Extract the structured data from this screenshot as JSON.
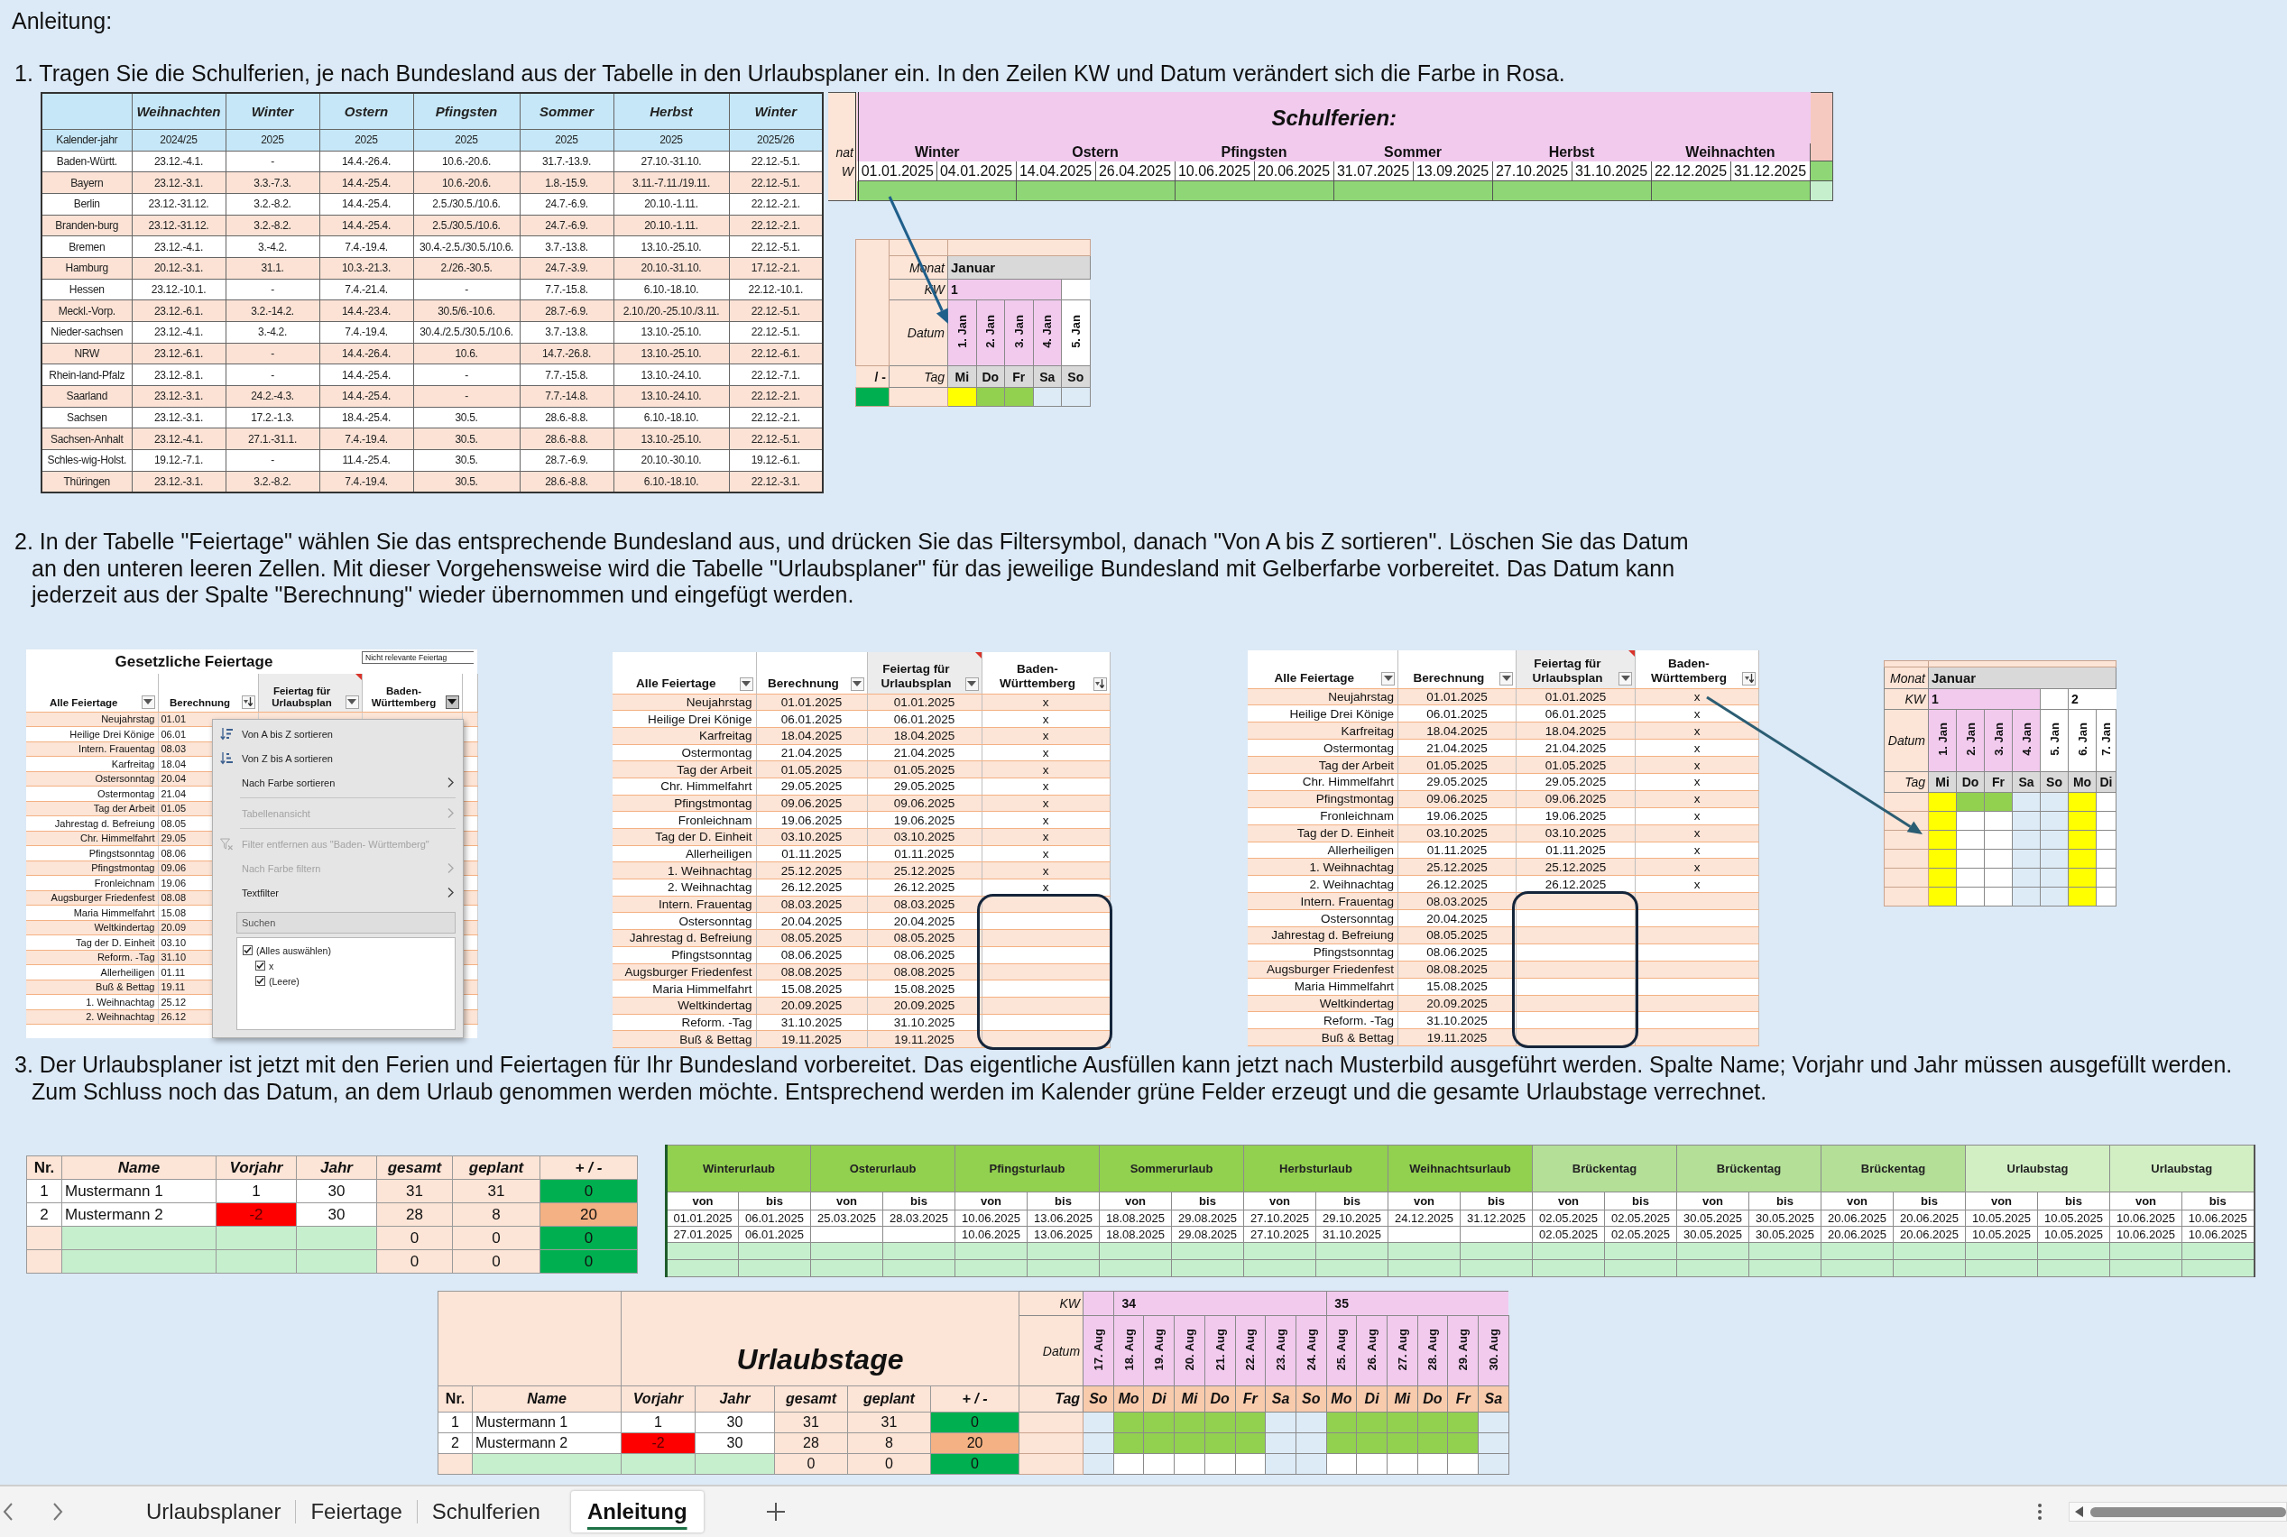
{
  "heading": "Anleitung:",
  "step_1": {
    "lines": [
      "1. Tragen Sie die Schulferien, je nach Bundesland aus der Tabelle in den Urlaubsplaner ein. In den Zeilen KW und Datum verändert sich die Farbe in Rosa."
    ],
    "state_table": {
      "columns": [
        "Weihnachten",
        "Winter",
        "Ostern",
        "Pfingsten",
        "Sommer",
        "Herbst",
        "Winter"
      ],
      "year_label": "Kalender-jahr",
      "years": [
        "2024/25",
        "2025",
        "2025",
        "2025",
        "2025",
        "2025",
        "2025/26"
      ],
      "rows": [
        {
          "state": "Baden-Württ.",
          "periods": [
            "23.12.-4.1.",
            "-",
            "14.4.-26.4.",
            "10.6.-20.6.",
            "31.7.-13.9.",
            "27.10.-31.10.",
            "22.12.-5.1."
          ]
        },
        {
          "state": "Bayern",
          "periods": [
            "23.12.-3.1.",
            "3.3.-7.3.",
            "14.4.-25.4.",
            "10.6.-20.6.",
            "1.8.-15.9.",
            "3.11.-7.11./19.11.",
            "22.12.-5.1."
          ]
        },
        {
          "state": "Berlin",
          "periods": [
            "23.12.-31.12.",
            "3.2.-8.2.",
            "14.4.-25.4.",
            "2.5./30.5./10.6.",
            "24.7.-6.9.",
            "20.10.-1.11.",
            "22.12.-2.1."
          ]
        },
        {
          "state": "Branden-burg",
          "periods": [
            "23.12.-31.12.",
            "3.2.-8.2.",
            "14.4.-25.4.",
            "2.5./30.5./10.6.",
            "24.7.-6.9.",
            "20.10.-1.11.",
            "22.12.-2.1."
          ]
        },
        {
          "state": "Bremen",
          "periods": [
            "23.12.-4.1.",
            "3.-4.2.",
            "7.4.-19.4.",
            "30.4.-2.5./30.5./10.6.",
            "3.7.-13.8.",
            "13.10.-25.10.",
            "22.12.-5.1."
          ]
        },
        {
          "state": "Hamburg",
          "periods": [
            "20.12.-3.1.",
            "31.1.",
            "10.3.-21.3.",
            "2./26.-30.5.",
            "24.7.-3.9.",
            "20.10.-31.10.",
            "17.12.-2.1."
          ]
        },
        {
          "state": "Hessen",
          "periods": [
            "23.12.-10.1.",
            "-",
            "7.4.-21.4.",
            "-",
            "7.7.-15.8.",
            "6.10.-18.10.",
            "22.12.-10.1."
          ]
        },
        {
          "state": "Meckl.-Vorp.",
          "periods": [
            "23.12.-6.1.",
            "3.2.-14.2.",
            "14.4.-23.4.",
            "30.5/6.-10.6.",
            "28.7.-6.9.",
            "2.10./20.-25.10./3.11.",
            "22.12.-5.1."
          ]
        },
        {
          "state": "Nieder-sachsen",
          "periods": [
            "23.12.-4.1.",
            "3.-4.2.",
            "7.4.-19.4.",
            "30.4./2.5./30.5./10.6.",
            "3.7.-13.8.",
            "13.10.-25.10.",
            "22.12.-5.1."
          ]
        },
        {
          "state": "NRW",
          "periods": [
            "23.12.-6.1.",
            "-",
            "14.4.-26.4.",
            "10.6.",
            "14.7.-26.8.",
            "13.10.-25.10.",
            "22.12.-6.1."
          ]
        },
        {
          "state": "Rhein-land-Pfalz",
          "periods": [
            "23.12.-8.1.",
            "-",
            "14.4.-25.4.",
            "-",
            "7.7.-15.8.",
            "13.10.-24.10.",
            "22.12.-7.1."
          ]
        },
        {
          "state": "Saarland",
          "periods": [
            "23.12.-3.1.",
            "24.2.-4.3.",
            "14.4.-25.4.",
            "-",
            "7.7.-14.8.",
            "13.10.-24.10.",
            "22.12.-2.1."
          ]
        },
        {
          "state": "Sachsen",
          "periods": [
            "23.12.-3.1.",
            "17.2.-1.3.",
            "18.4.-25.4.",
            "30.5.",
            "28.6.-8.8.",
            "6.10.-18.10.",
            "22.12.-2.1."
          ]
        },
        {
          "state": "Sachsen-Anhalt",
          "periods": [
            "23.12.-4.1.",
            "27.1.-31.1.",
            "7.4.-19.4.",
            "30.5.",
            "28.6.-8.8.",
            "13.10.-25.10.",
            "22.12.-5.1."
          ]
        },
        {
          "state": "Schles-wig-Holst.",
          "periods": [
            "19.12.-7.1.",
            "-",
            "11.4.-25.4.",
            "30.5.",
            "28.7.-6.9.",
            "20.10.-30.10.",
            "19.12.-6.1."
          ]
        },
        {
          "state": "Thüringen",
          "periods": [
            "23.12.-3.1.",
            "3.2.-8.2.",
            "7.4.-19.4.",
            "30.5.",
            "28.6.-8.8.",
            "6.10.-18.10.",
            "22.12.-3.1."
          ]
        }
      ]
    },
    "school_holidays": {
      "cut_row_labels": [
        "nat",
        "W"
      ],
      "title": "Schulferien:",
      "periods": [
        {
          "name": "Winter",
          "from": "01.01.2025",
          "to": "04.01.2025"
        },
        {
          "name": "Ostern",
          "from": "14.04.2025",
          "to": "26.04.2025"
        },
        {
          "name": "Pfingsten",
          "from": "10.06.2025",
          "to": "20.06.2025"
        },
        {
          "name": "Sommer",
          "from": "31.07.2025",
          "to": "13.09.2025"
        },
        {
          "name": "Herbst",
          "from": "27.10.2025",
          "to": "31.10.2025"
        },
        {
          "name": "Weihnachten",
          "from": "22.12.2025",
          "to": "31.12.2025"
        }
      ]
    },
    "calendar": {
      "cut_column_label": "/ -",
      "cut_balanced": true,
      "month_label": "Monat",
      "month": "Januar",
      "week_label": "KW",
      "date_label": "Datum",
      "day_label": "Tag",
      "days": [
        {
          "date": "1. Jan",
          "weekday": "Mi",
          "week": "1",
          "school_holiday": true
        },
        {
          "date": "2. Jan",
          "weekday": "Do",
          "school_holiday": true
        },
        {
          "date": "3. Jan",
          "weekday": "Fr",
          "school_holiday": true
        },
        {
          "date": "4. Jan",
          "weekday": "Sa",
          "school_holiday": true
        },
        {
          "date": "5. Jan",
          "weekday": "So",
          "school_holiday": false
        }
      ],
      "grid": [
        [
          {
            "kind": "holiday"
          },
          {
            "kind": "vacation"
          },
          {
            "kind": "vacation"
          },
          {
            "kind": "weekend"
          },
          {
            "kind": "weekend"
          }
        ]
      ]
    }
  },
  "step_2": {
    "lines": [
      "2. In der Tabelle \"Feiertage\" wählen Sie das entsprechende Bundesland aus, und drücken Sie das Filtersymbol, danach \"Von A bis Z sortieren\". Löschen Sie das Datum",
      "an den unteren leeren Zellen. Mit dieser Vorgehensweise wird die Tabelle \"Urlaubsplaner\" für das jeweilige Bundesland mit Gelberfarbe vorbereitet. Das Datum kann",
      "jederzeit aus der Spalte \"Berechnung\" wieder übernommen und eingefügt werden."
    ],
    "filter_screenshot": {
      "title": "Gesetzliche Feiertage",
      "note": "Nicht relevante Feiertag",
      "columns": [
        {
          "label": "Alle Feiertage",
          "sorted": false,
          "active": false
        },
        {
          "label": "Berechnung",
          "sorted": true,
          "active": false
        },
        {
          "label": "Feiertag für Urlaubsplan",
          "sorted": false,
          "active": false
        },
        {
          "label": "Baden-Württemberg",
          "sorted": false,
          "active": true
        }
      ],
      "rows": [
        {
          "name": "Neujahrstag",
          "date": "01.01"
        },
        {
          "name": "Heilige Drei Könige",
          "date": "06.01"
        },
        {
          "name": "Intern. Frauentag",
          "date": "08.03"
        },
        {
          "name": "Karfreitag",
          "date": "18.04"
        },
        {
          "name": "Ostersonntag",
          "date": "20.04"
        },
        {
          "name": "Ostermontag",
          "date": "21.04"
        },
        {
          "name": "Tag der Arbeit",
          "date": "01.05"
        },
        {
          "name": "Jahrestag d. Befreiung",
          "date": "08.05"
        },
        {
          "name": "Chr. Himmelfahrt",
          "date": "29.05"
        },
        {
          "name": "Pfingstsonntag",
          "date": "08.06"
        },
        {
          "name": "Pfingstmontag",
          "date": "09.06"
        },
        {
          "name": "Fronleichnam",
          "date": "19.06"
        },
        {
          "name": "Augsburger Friedenfest",
          "date": "08.08"
        },
        {
          "name": "Maria Himmelfahrt",
          "date": "15.08"
        },
        {
          "name": "Weltkindertag",
          "date": "20.09"
        },
        {
          "name": "Tag der D. Einheit",
          "date": "03.10"
        },
        {
          "name": "Reform. -Tag",
          "date": "31.10"
        },
        {
          "name": "Allerheiligen",
          "date": "01.11"
        },
        {
          "name": "Buß & Bettag",
          "date": "19.11"
        },
        {
          "name": "1. Weihnachtag",
          "date": "25.12"
        },
        {
          "name": "2. Weihnachtag",
          "date": "26.12"
        }
      ],
      "menu": {
        "items": [
          {
            "label": "Von A bis Z sortieren",
            "kind": "sort_up",
            "disabled": false,
            "separator_after": false
          },
          {
            "label": "Von Z bis A sortieren",
            "kind": "sort_down",
            "disabled": false,
            "separator_after": false
          },
          {
            "label": "Nach Farbe sortieren",
            "kind": "submenu",
            "disabled": false,
            "separator_after": true
          },
          {
            "label": "Tabellenansicht",
            "kind": "submenu",
            "disabled": true,
            "separator_after": true
          },
          {
            "label": "Filter entfernen aus \"Baden- Württemberg\"",
            "kind": "clear_filter",
            "disabled": true,
            "separator_after": false
          },
          {
            "label": "Nach Farbe filtern",
            "kind": "submenu",
            "disabled": true,
            "separator_after": false
          },
          {
            "label": "Textfilter",
            "kind": "submenu",
            "disabled": false,
            "separator_after": false
          }
        ],
        "search": {
          "placeholder": "Suchen"
        },
        "options": [
          {
            "label": "(Alles auswählen)",
            "checked": true,
            "children": [
              {
                "label": "x",
                "checked": true
              },
              {
                "label": "(Leere)",
                "checked": true
              }
            ]
          }
        ]
      }
    },
    "sorted_table": {
      "columns": [
        {
          "label": "Alle Feiertage",
          "sorted": false,
          "highlighted": false
        },
        {
          "label": "Berechnung",
          "sorted": false,
          "highlighted": false
        },
        {
          "label": "Feiertag für Urlaubsplan",
          "sorted": false,
          "highlighted": false
        },
        {
          "label": "Baden-Württemberg",
          "sorted": true,
          "highlighted": true
        }
      ],
      "rows": [
        {
          "name": "Neujahrstag",
          "date": "01.01.2025",
          "plan_date": "01.01.2025",
          "region_mark": "x"
        },
        {
          "name": "Heilige Drei Könige",
          "date": "06.01.2025",
          "plan_date": "06.01.2025",
          "region_mark": "x"
        },
        {
          "name": "Karfreitag",
          "date": "18.04.2025",
          "plan_date": "18.04.2025",
          "region_mark": "x"
        },
        {
          "name": "Ostermontag",
          "date": "21.04.2025",
          "plan_date": "21.04.2025",
          "region_mark": "x"
        },
        {
          "name": "Tag der Arbeit",
          "date": "01.05.2025",
          "plan_date": "01.05.2025",
          "region_mark": "x"
        },
        {
          "name": "Chr. Himmelfahrt",
          "date": "29.05.2025",
          "plan_date": "29.05.2025",
          "region_mark": "x"
        },
        {
          "name": "Pfingstmontag",
          "date": "09.06.2025",
          "plan_date": "09.06.2025",
          "region_mark": "x"
        },
        {
          "name": "Fronleichnam",
          "date": "19.06.2025",
          "plan_date": "19.06.2025",
          "region_mark": "x"
        },
        {
          "name": "Tag der D. Einheit",
          "date": "03.10.2025",
          "plan_date": "03.10.2025",
          "region_mark": "x"
        },
        {
          "name": "Allerheiligen",
          "date": "01.11.2025",
          "plan_date": "01.11.2025",
          "region_mark": "x"
        },
        {
          "name": "1. Weihnachtag",
          "date": "25.12.2025",
          "plan_date": "25.12.2025",
          "region_mark": "x"
        },
        {
          "name": "2. Weihnachtag",
          "date": "26.12.2025",
          "plan_date": "26.12.2025",
          "region_mark": "x"
        },
        {
          "name": "Intern. Frauentag",
          "date": "08.03.2025",
          "plan_date": "08.03.2025"
        },
        {
          "name": "Ostersonntag",
          "date": "20.04.2025",
          "plan_date": "20.04.2025"
        },
        {
          "name": "Jahrestag d. Befreiung",
          "date": "08.05.2025",
          "plan_date": "08.05.2025"
        },
        {
          "name": "Pfingstsonntag",
          "date": "08.06.2025",
          "plan_date": "08.06.2025"
        },
        {
          "name": "Augsburger Friedenfest",
          "date": "08.08.2025",
          "plan_date": "08.08.2025"
        },
        {
          "name": "Maria Himmelfahrt",
          "date": "15.08.2025",
          "plan_date": "15.08.2025"
        },
        {
          "name": "Weltkindertag",
          "date": "20.09.2025",
          "plan_date": "20.09.2025"
        },
        {
          "name": "Reform. -Tag",
          "date": "31.10.2025",
          "plan_date": "31.10.2025"
        },
        {
          "name": "Buß & Bettag",
          "date": "19.11.2025",
          "plan_date": "19.11.2025"
        }
      ]
    },
    "cleared_table": {
      "columns": [
        {
          "label": "Alle Feiertage",
          "sorted": false,
          "highlighted": false
        },
        {
          "label": "Berechnung",
          "sorted": false,
          "highlighted": false
        },
        {
          "label": "Feiertag für Urlaubsplan",
          "sorted": false,
          "highlighted": true
        },
        {
          "label": "Baden-Württemberg",
          "sorted": true,
          "highlighted": false
        }
      ],
      "rows": [
        {
          "name": "Neujahrstag",
          "date": "01.01.2025",
          "plan_date": "01.01.2025",
          "region_mark": "x"
        },
        {
          "name": "Heilige Drei Könige",
          "date": "06.01.2025",
          "plan_date": "06.01.2025",
          "region_mark": "x"
        },
        {
          "name": "Karfreitag",
          "date": "18.04.2025",
          "plan_date": "18.04.2025",
          "region_mark": "x"
        },
        {
          "name": "Ostermontag",
          "date": "21.04.2025",
          "plan_date": "21.04.2025",
          "region_mark": "x"
        },
        {
          "name": "Tag der Arbeit",
          "date": "01.05.2025",
          "plan_date": "01.05.2025",
          "region_mark": "x"
        },
        {
          "name": "Chr. Himmelfahrt",
          "date": "29.05.2025",
          "plan_date": "29.05.2025",
          "region_mark": "x"
        },
        {
          "name": "Pfingstmontag",
          "date": "09.06.2025",
          "plan_date": "09.06.2025",
          "region_mark": "x"
        },
        {
          "name": "Fronleichnam",
          "date": "19.06.2025",
          "plan_date": "19.06.2025",
          "region_mark": "x"
        },
        {
          "name": "Tag der D. Einheit",
          "date": "03.10.2025",
          "plan_date": "03.10.2025",
          "region_mark": "x"
        },
        {
          "name": "Allerheiligen",
          "date": "01.11.2025",
          "plan_date": "01.11.2025",
          "region_mark": "x"
        },
        {
          "name": "1. Weihnachtag",
          "date": "25.12.2025",
          "plan_date": "25.12.2025",
          "region_mark": "x"
        },
        {
          "name": "2. Weihnachtag",
          "date": "26.12.2025",
          "plan_date": "26.12.2025",
          "region_mark": "x"
        },
        {
          "name": "Intern. Frauentag",
          "date": "08.03.2025"
        },
        {
          "name": "Ostersonntag",
          "date": "20.04.2025"
        },
        {
          "name": "Jahrestag d. Befreiung",
          "date": "08.05.2025"
        },
        {
          "name": "Pfingstsonntag",
          "date": "08.06.2025"
        },
        {
          "name": "Augsburger Friedenfest",
          "date": "08.08.2025"
        },
        {
          "name": "Maria Himmelfahrt",
          "date": "15.08.2025"
        },
        {
          "name": "Weltkindertag",
          "date": "20.09.2025"
        },
        {
          "name": "Reform. -Tag",
          "date": "31.10.2025"
        },
        {
          "name": "Buß & Bettag",
          "date": "19.11.2025"
        }
      ]
    },
    "calendar": {
      "month_label": "Monat",
      "month": "Januar",
      "week_label": "KW",
      "date_label": "Datum",
      "day_label": "Tag",
      "days": [
        {
          "date": "1. Jan",
          "weekday": "Mi",
          "week": "1",
          "school_holiday": true
        },
        {
          "date": "2. Jan",
          "weekday": "Do",
          "school_holiday": true
        },
        {
          "date": "3. Jan",
          "weekday": "Fr",
          "school_holiday": true
        },
        {
          "date": "4. Jan",
          "weekday": "Sa",
          "school_holiday": true
        },
        {
          "date": "5. Jan",
          "weekday": "So",
          "school_holiday": false
        },
        {
          "date": "6. Jan",
          "weekday": "Mo",
          "week": "2",
          "school_holiday": false
        },
        {
          "date": "7. Jan",
          "weekday": "Di",
          "school_holiday": false
        }
      ],
      "grid": [
        [
          {
            "kind": "holiday"
          },
          {
            "kind": "vacation"
          },
          {
            "kind": "vacation"
          },
          {
            "kind": "weekend"
          },
          {
            "kind": "weekend"
          },
          {
            "kind": "holiday"
          },
          {
            "kind": "free"
          }
        ],
        [
          {
            "kind": "holiday"
          },
          {
            "kind": "free"
          },
          {
            "kind": "free"
          },
          {
            "kind": "weekend"
          },
          {
            "kind": "weekend"
          },
          {
            "kind": "holiday"
          },
          {
            "kind": "free"
          }
        ],
        [
          {
            "kind": "holiday"
          },
          {
            "kind": "free"
          },
          {
            "kind": "free"
          },
          {
            "kind": "weekend"
          },
          {
            "kind": "weekend"
          },
          {
            "kind": "holiday"
          },
          {
            "kind": "free"
          }
        ],
        [
          {
            "kind": "holiday"
          },
          {
            "kind": "free"
          },
          {
            "kind": "free"
          },
          {
            "kind": "weekend"
          },
          {
            "kind": "weekend"
          },
          {
            "kind": "holiday"
          },
          {
            "kind": "free"
          }
        ],
        [
          {
            "kind": "holiday"
          },
          {
            "kind": "free"
          },
          {
            "kind": "free"
          },
          {
            "kind": "weekend"
          },
          {
            "kind": "weekend"
          },
          {
            "kind": "holiday"
          },
          {
            "kind": "free"
          }
        ],
        [
          {
            "kind": "holiday"
          },
          {
            "kind": "free"
          },
          {
            "kind": "free"
          },
          {
            "kind": "weekend"
          },
          {
            "kind": "weekend"
          },
          {
            "kind": "holiday"
          },
          {
            "kind": "free"
          }
        ]
      ]
    }
  },
  "step_3": {
    "lines": [
      "3. Der Urlaubsplaner ist jetzt mit den Ferien und Feiertagen für Ihr Bundesland vorbereitet. Das eigentliche Ausfüllen kann jetzt nach Musterbild ausgeführt werden. Spalte Name; Vorjahr und Jahr müssen ausgefüllt werden.",
      "Zum Schluss noch das Datum, an dem Urlaub genommen werden möchte. Entsprechend werden im Kalender grüne Felder erzeugt und die gesamte Urlaubstage verrechnet."
    ],
    "staff_table": {
      "columns": [
        "Nr.",
        "Name",
        "Vorjahr",
        "Jahr",
        "gesamt",
        "geplant",
        "+ / -"
      ],
      "rows": [
        {
          "nr": "1",
          "name": "Mustermann 1",
          "previous_year": "1",
          "previous_negative": false,
          "year": "30",
          "total": "31",
          "planned": "31",
          "balance": "0",
          "balanced": true
        },
        {
          "nr": "2",
          "name": "Mustermann 2",
          "previous_year": "-2",
          "previous_negative": true,
          "year": "30",
          "total": "28",
          "planned": "8",
          "balance": "20",
          "balanced": false
        },
        {
          "total": "0",
          "planned": "0",
          "balance": "0",
          "balanced": true
        },
        {
          "total": "0",
          "planned": "0",
          "balance": "0",
          "balanced": true
        }
      ]
    },
    "leave_table": {
      "groups": [
        {
          "name": "Winterurlaub",
          "kind": "vacation",
          "from_label": "von",
          "to_label": "bis"
        },
        {
          "name": "Osterurlaub",
          "kind": "vacation",
          "from_label": "von",
          "to_label": "bis"
        },
        {
          "name": "Pfingsturlaub",
          "kind": "vacation",
          "from_label": "von",
          "to_label": "bis"
        },
        {
          "name": "Sommerurlaub",
          "kind": "vacation",
          "from_label": "von",
          "to_label": "bis"
        },
        {
          "name": "Herbsturlaub",
          "kind": "vacation",
          "from_label": "von",
          "to_label": "bis"
        },
        {
          "name": "Weihnachtsurlaub",
          "kind": "vacation",
          "from_label": "von",
          "to_label": "bis"
        },
        {
          "name": "Brückentag",
          "kind": "bridge",
          "from_label": "von",
          "to_label": "bis"
        },
        {
          "name": "Brückentag",
          "kind": "bridge",
          "from_label": "von",
          "to_label": "bis"
        },
        {
          "name": "Brückentag",
          "kind": "bridge",
          "from_label": "von",
          "to_label": "bis"
        },
        {
          "name": "Urlaubstag",
          "kind": "single",
          "from_label": "von",
          "to_label": "bis"
        },
        {
          "name": "Urlaubstag",
          "kind": "single",
          "from_label": "von",
          "to_label": "bis"
        }
      ],
      "rows": [
        [
          [
            "01.01.2025",
            "06.01.2025"
          ],
          [
            "25.03.2025",
            "28.03.2025"
          ],
          [
            "10.06.2025",
            "13.06.2025"
          ],
          [
            "18.08.2025",
            "29.08.2025"
          ],
          [
            "27.10.2025",
            "29.10.2025"
          ],
          [
            "24.12.2025",
            "31.12.2025"
          ],
          [
            "02.05.2025",
            "02.05.2025"
          ],
          [
            "30.05.2025",
            "30.05.2025"
          ],
          [
            "20.06.2025",
            "20.06.2025"
          ],
          [
            "10.05.2025",
            "10.05.2025"
          ],
          [
            "10.06.2025",
            "10.06.2025"
          ]
        ],
        [
          [
            "27.01.2025",
            "06.01.2025"
          ],
          null,
          [
            "10.06.2025",
            "13.06.2025"
          ],
          [
            "18.08.2025",
            "29.08.2025"
          ],
          [
            "27.10.2025",
            "31.10.2025"
          ],
          null,
          [
            "02.05.2025",
            "02.05.2025"
          ],
          [
            "30.05.2025",
            "30.05.2025"
          ],
          [
            "20.06.2025",
            "20.06.2025"
          ],
          [
            "10.05.2025",
            "10.05.2025"
          ],
          [
            "10.06.2025",
            "10.06.2025"
          ]
        ]
      ]
    },
    "vacation_days": {
      "title": "Urlaubstage",
      "columns": [
        "Nr.",
        "Name",
        "Vorjahr",
        "Jahr",
        "gesamt",
        "geplant",
        "+ / -"
      ],
      "rows": [
        {
          "nr": "1",
          "name": "Mustermann 1",
          "previous_year": "1",
          "previous_negative": false,
          "year": "30",
          "total": "31",
          "planned": "31",
          "balance": "0",
          "balanced": true
        },
        {
          "nr": "2",
          "name": "Mustermann 2",
          "previous_year": "-2",
          "previous_negative": true,
          "year": "30",
          "total": "28",
          "planned": "8",
          "balance": "20",
          "balanced": false
        },
        {
          "total": "0",
          "planned": "0",
          "balance": "0",
          "balanced": true
        }
      ],
      "calendar": {
        "week_label": "KW",
        "date_label": "Datum",
        "day_label": "Tag",
        "days": [
          {
            "date": "17. Aug",
            "weekday": "So",
            "school_holiday": true
          },
          {
            "date": "18. Aug",
            "weekday": "Mo",
            "week": "34",
            "school_holiday": true
          },
          {
            "date": "19. Aug",
            "weekday": "Di",
            "school_holiday": true
          },
          {
            "date": "20. Aug",
            "weekday": "Mi",
            "school_holiday": true
          },
          {
            "date": "21. Aug",
            "weekday": "Do",
            "school_holiday": true
          },
          {
            "date": "22. Aug",
            "weekday": "Fr",
            "school_holiday": true
          },
          {
            "date": "23. Aug",
            "weekday": "Sa",
            "school_holiday": true
          },
          {
            "date": "24. Aug",
            "weekday": "So",
            "school_holiday": true
          },
          {
            "date": "25. Aug",
            "weekday": "Mo",
            "week": "35",
            "school_holiday": true
          },
          {
            "date": "26. Aug",
            "weekday": "Di",
            "school_holiday": true
          },
          {
            "date": "27. Aug",
            "weekday": "Mi",
            "school_holiday": true
          },
          {
            "date": "28. Aug",
            "weekday": "Do",
            "school_holiday": true
          },
          {
            "date": "29. Aug",
            "weekday": "Fr",
            "school_holiday": true
          },
          {
            "date": "30. Aug",
            "weekday": "Sa",
            "school_holiday": true
          }
        ],
        "grid": [
          [
            {
              "kind": "weekend"
            },
            {
              "kind": "vacation"
            },
            {
              "kind": "vacation"
            },
            {
              "kind": "vacation"
            },
            {
              "kind": "vacation"
            },
            {
              "kind": "vacation"
            },
            {
              "kind": "weekend"
            },
            {
              "kind": "weekend"
            },
            {
              "kind": "vacation"
            },
            {
              "kind": "vacation"
            },
            {
              "kind": "vacation"
            },
            {
              "kind": "vacation"
            },
            {
              "kind": "vacation"
            },
            {
              "kind": "weekend"
            }
          ],
          [
            {
              "kind": "weekend"
            },
            {
              "kind": "vacation"
            },
            {
              "kind": "vacation"
            },
            {
              "kind": "vacation"
            },
            {
              "kind": "vacation"
            },
            {
              "kind": "vacation"
            },
            {
              "kind": "weekend"
            },
            {
              "kind": "weekend"
            },
            {
              "kind": "vacation"
            },
            {
              "kind": "vacation"
            },
            {
              "kind": "vacation"
            },
            {
              "kind": "vacation"
            },
            {
              "kind": "vacation"
            },
            {
              "kind": "weekend"
            }
          ],
          [
            {
              "kind": "weekend"
            },
            {
              "kind": "free"
            },
            {
              "kind": "free"
            },
            {
              "kind": "free"
            },
            {
              "kind": "free"
            },
            {
              "kind": "free"
            },
            {
              "kind": "weekend"
            },
            {
              "kind": "weekend"
            },
            {
              "kind": "free"
            },
            {
              "kind": "free"
            },
            {
              "kind": "free"
            },
            {
              "kind": "free"
            },
            {
              "kind": "free"
            },
            {
              "kind": "weekend"
            }
          ]
        ]
      }
    }
  },
  "sheet_tabs": {
    "tabs": [
      {
        "label": "Urlaubsplaner",
        "selected": false
      },
      {
        "label": "Feiertage",
        "selected": false
      },
      {
        "label": "Schulferien",
        "selected": false
      },
      {
        "label": "Anleitung",
        "selected": true
      }
    ]
  }
}
